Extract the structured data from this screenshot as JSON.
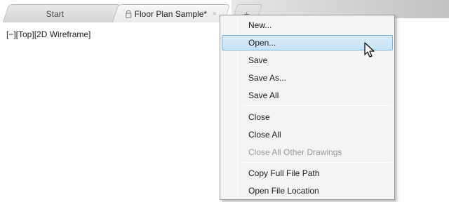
{
  "tabs": [
    {
      "label": "Start"
    },
    {
      "label": "Floor Plan Sample*",
      "close": "×"
    }
  ],
  "new_tab_glyph": "+",
  "viewport": {
    "label": "[−][Top][2D Wireframe]"
  },
  "context_menu": {
    "items": [
      {
        "label": "New..."
      },
      {
        "label": "Open...",
        "state": "hover"
      },
      {
        "label": "Save"
      },
      {
        "label": "Save As..."
      },
      {
        "label": "Save All"
      },
      {
        "label": "Close"
      },
      {
        "label": "Close All"
      },
      {
        "label": "Close All Other Drawings",
        "state": "disabled"
      },
      {
        "label": "Copy Full File Path"
      },
      {
        "label": "Open File Location"
      }
    ]
  },
  "icons": {
    "lock": "lock-icon",
    "cursor": "arrow-cursor-icon"
  },
  "colors": {
    "hover_fill": "#c6e3f6",
    "hover_border": "#7fb4dd",
    "disabled_text": "#9a9a9a"
  }
}
